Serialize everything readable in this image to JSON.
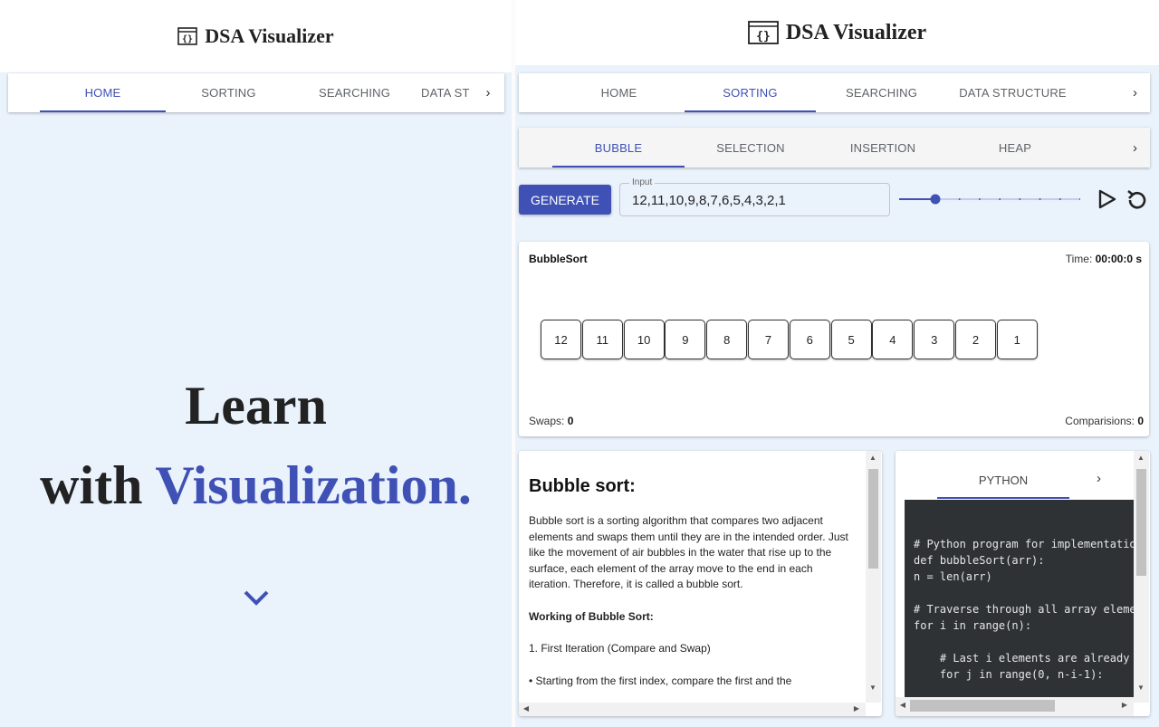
{
  "app": {
    "title": "DSA Visualizer"
  },
  "left": {
    "nav": {
      "tabs": [
        "HOME",
        "SORTING",
        "SEARCHING",
        "DATA ST"
      ],
      "active": 0
    },
    "hero": {
      "line1": "Learn",
      "line2_prefix": "with ",
      "line2_accent": "Visualization."
    }
  },
  "right": {
    "nav": {
      "tabs": [
        "HOME",
        "SORTING",
        "SEARCHING",
        "DATA STRUCTURE"
      ],
      "active": 1
    },
    "subnav": {
      "tabs": [
        "BUBBLE",
        "SELECTION",
        "INSERTION",
        "HEAP"
      ],
      "active": 0
    },
    "controls": {
      "generate_label": "GENERATE",
      "input_label": "Input",
      "input_value": "12,11,10,9,8,7,6,5,4,3,2,1",
      "speed_level": 0.2
    },
    "viz": {
      "title": "BubbleSort",
      "time_label": "Time: ",
      "time_value": "00:00:0 s",
      "array": [
        12,
        11,
        10,
        9,
        8,
        7,
        6,
        5,
        4,
        3,
        2,
        1
      ],
      "swaps_label": "Swaps: ",
      "swaps_value": "0",
      "comparisons_label": "Comparisions: ",
      "comparisons_value": "0"
    },
    "description": {
      "heading": "Bubble sort:",
      "intro": "Bubble sort is a sorting algorithm that compares two adjacent elements and swaps them until they are in the intended order. Just like the movement of air bubbles in the water that rise up to the surface, each element of the array move to the end in each iteration. Therefore, it is called a bubble sort.",
      "working_heading": "Working of Bubble Sort:",
      "step1": "1. First Iteration (Compare and Swap)",
      "step1_detail": "• Starting from the first index, compare the first and the"
    },
    "code": {
      "tab": "PYTHON",
      "lines": [
        "# Python program for implementation of Bubble Sort",
        "def bubbleSort(arr):",
        "n = len(arr)",
        "",
        "# Traverse through all array elements",
        "for i in range(n):",
        "",
        "    # Last i elements are already in place",
        "    for j in range(0, n-i-1):"
      ]
    }
  }
}
